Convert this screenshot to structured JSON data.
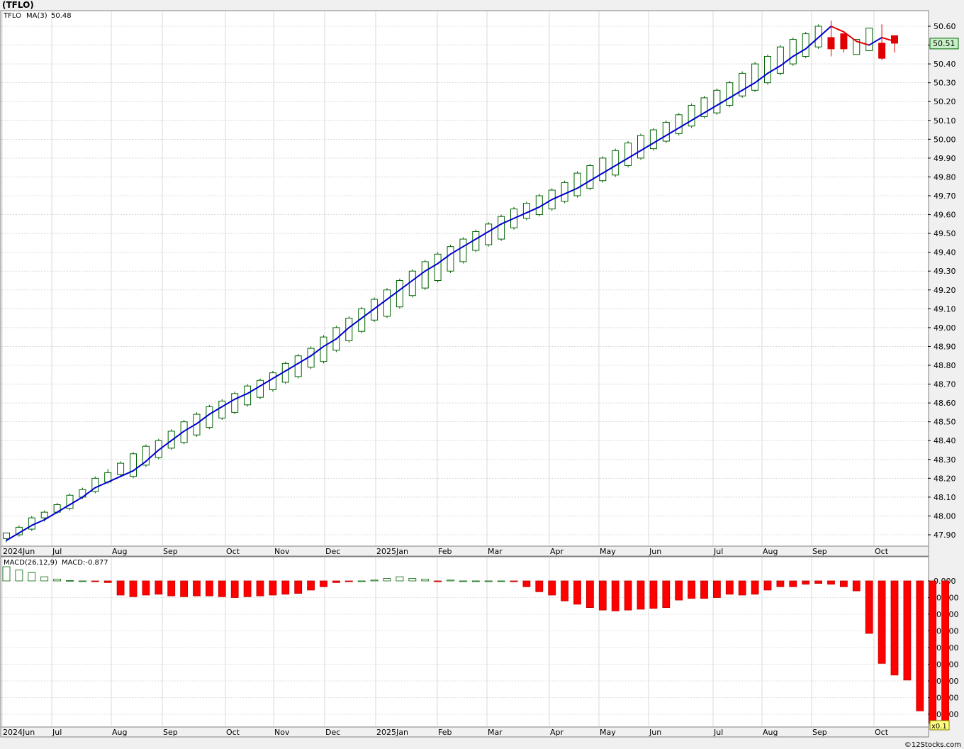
{
  "title": "(TFLO)",
  "credit": "©12Stocks.com",
  "price_panel": {
    "symbol": "TFLO",
    "ma_label": "MA(3)",
    "ma_value": "50.48",
    "last_price_label": "50.51",
    "y_ticks": [
      "47.90",
      "48.00",
      "48.10",
      "48.20",
      "48.30",
      "48.40",
      "48.50",
      "48.60",
      "48.70",
      "48.80",
      "48.90",
      "49.00",
      "49.10",
      "49.20",
      "49.30",
      "49.40",
      "49.50",
      "49.60",
      "49.70",
      "49.80",
      "49.90",
      "50.00",
      "50.10",
      "50.20",
      "50.30",
      "50.40",
      "50.50",
      "50.60"
    ]
  },
  "macd_panel": {
    "label": "MACD(26,12,9)",
    "value_label": "MACD:-0.877",
    "scale_label": "x0.1",
    "y_ticks": [
      "0.000",
      "-0.100",
      "-0.200",
      "-0.300",
      "-0.400",
      "-0.500",
      "-0.600",
      "-0.700",
      "-0.800"
    ]
  },
  "x_axis_labels": [
    "2024Jun",
    "Jul",
    "Aug",
    "Sep",
    "Oct",
    "Nov",
    "Dec",
    "2025Jan",
    "Feb",
    "Mar",
    "Apr",
    "May",
    "Jun",
    "Jul",
    "Aug",
    "Sep",
    "Oct"
  ],
  "colors": {
    "up_candle_fill": "#ffffff",
    "up_candle_stroke": "#006400",
    "down_candle": "#e00000",
    "ma_up": "#0000d0",
    "ma_down": "#e00000",
    "macd_bar": "#ff0000",
    "grid": "#c0c0c0",
    "price_label_bg": "#c8f0c8"
  },
  "chart_data": [
    {
      "type": "candlestick",
      "title": "(TFLO)",
      "ylim": [
        47.86,
        50.65
      ],
      "x": [
        "2024-06-03",
        "2024-06-10",
        "2024-06-17",
        "2024-06-24",
        "2024-07-01",
        "2024-07-08",
        "2024-07-15",
        "2024-07-22",
        "2024-07-29",
        "2024-08-05",
        "2024-08-12",
        "2024-08-19",
        "2024-08-26",
        "2024-09-02",
        "2024-09-09",
        "2024-09-16",
        "2024-09-23",
        "2024-09-30",
        "2024-10-07",
        "2024-10-14",
        "2024-10-21",
        "2024-10-28",
        "2024-11-04",
        "2024-11-11",
        "2024-11-18",
        "2024-11-25",
        "2024-12-02",
        "2024-12-09",
        "2024-12-16",
        "2024-12-23",
        "2024-12-30",
        "2025-01-06",
        "2025-01-13",
        "2025-01-20",
        "2025-01-27",
        "2025-02-03",
        "2025-02-10",
        "2025-02-17",
        "2025-02-24",
        "2025-03-03",
        "2025-03-10",
        "2025-03-17",
        "2025-03-24",
        "2025-03-31",
        "2025-04-07",
        "2025-04-14",
        "2025-04-21",
        "2025-04-28",
        "2025-05-05",
        "2025-05-12",
        "2025-05-19",
        "2025-05-26",
        "2025-06-02",
        "2025-06-09",
        "2025-06-16",
        "2025-06-23",
        "2025-06-30",
        "2025-07-07",
        "2025-07-14",
        "2025-07-21",
        "2025-07-28",
        "2025-08-04",
        "2025-08-11",
        "2025-08-18",
        "2025-08-25",
        "2025-09-01",
        "2025-09-08",
        "2025-09-15",
        "2025-09-22",
        "2025-09-29",
        "2025-10-06"
      ],
      "open": [
        47.88,
        47.9,
        47.93,
        47.99,
        48.02,
        48.04,
        48.1,
        48.13,
        48.18,
        48.22,
        48.21,
        48.27,
        48.31,
        48.36,
        48.39,
        48.43,
        48.47,
        48.52,
        48.55,
        48.59,
        48.63,
        48.67,
        48.71,
        48.74,
        48.79,
        48.82,
        48.88,
        48.93,
        48.98,
        49.04,
        49.06,
        49.11,
        49.17,
        49.21,
        49.25,
        49.3,
        49.35,
        49.41,
        49.44,
        49.47,
        49.53,
        49.58,
        49.6,
        49.63,
        49.67,
        49.7,
        49.74,
        49.78,
        49.81,
        49.86,
        49.9,
        49.95,
        49.99,
        50.03,
        50.07,
        50.12,
        50.14,
        50.18,
        50.23,
        50.26,
        50.3,
        50.35,
        50.4,
        50.44,
        50.49,
        50.54,
        50.56,
        50.45,
        50.47,
        50.51,
        50.55
      ],
      "high": [
        47.91,
        47.95,
        48.0,
        48.03,
        48.07,
        48.12,
        48.15,
        48.21,
        48.25,
        48.29,
        48.34,
        48.38,
        48.41,
        48.46,
        48.51,
        48.55,
        48.59,
        48.62,
        48.66,
        48.7,
        48.73,
        48.77,
        48.82,
        48.86,
        48.9,
        48.96,
        49.01,
        49.06,
        49.11,
        49.16,
        49.21,
        49.26,
        49.31,
        49.36,
        49.4,
        49.44,
        49.48,
        49.52,
        49.56,
        49.6,
        49.64,
        49.67,
        49.71,
        49.74,
        49.78,
        49.83,
        49.87,
        49.91,
        49.95,
        49.99,
        50.03,
        50.06,
        50.1,
        50.14,
        50.19,
        50.23,
        50.27,
        50.31,
        50.36,
        50.41,
        50.45,
        50.5,
        50.54,
        50.57,
        50.61,
        50.63,
        50.5,
        50.51,
        50.57,
        50.61,
        50.51
      ],
      "low": [
        47.86,
        47.89,
        47.92,
        47.97,
        48.01,
        48.03,
        48.09,
        48.12,
        48.17,
        48.21,
        48.2,
        48.26,
        48.3,
        48.35,
        48.38,
        48.42,
        48.46,
        48.51,
        48.54,
        48.58,
        48.62,
        48.66,
        48.7,
        48.73,
        48.78,
        48.81,
        48.87,
        48.92,
        48.97,
        49.03,
        49.05,
        49.1,
        49.16,
        49.2,
        49.24,
        49.29,
        49.34,
        49.4,
        49.43,
        49.46,
        49.52,
        49.57,
        49.59,
        49.62,
        49.66,
        49.69,
        49.73,
        49.77,
        49.8,
        49.85,
        49.89,
        49.94,
        49.98,
        50.02,
        50.06,
        50.11,
        50.13,
        50.17,
        50.22,
        50.25,
        50.29,
        50.34,
        50.39,
        50.43,
        50.48,
        50.44,
        50.46,
        50.49,
        50.52,
        50.42,
        50.46
      ],
      "close": [
        47.91,
        47.94,
        47.99,
        48.02,
        48.06,
        48.11,
        48.14,
        48.2,
        48.23,
        48.28,
        48.33,
        48.37,
        48.4,
        48.45,
        48.5,
        48.54,
        48.58,
        48.61,
        48.65,
        48.69,
        48.72,
        48.76,
        48.81,
        48.85,
        48.89,
        48.95,
        49.0,
        49.05,
        49.1,
        49.15,
        49.2,
        49.25,
        49.3,
        49.35,
        49.39,
        49.43,
        49.47,
        49.51,
        49.55,
        49.59,
        49.63,
        49.66,
        49.7,
        49.73,
        49.77,
        49.82,
        49.86,
        49.9,
        49.94,
        49.98,
        50.02,
        50.05,
        50.09,
        50.13,
        50.18,
        50.22,
        50.26,
        50.3,
        50.35,
        50.4,
        50.44,
        50.49,
        50.53,
        50.56,
        50.6,
        50.48,
        50.48,
        50.53,
        50.59,
        50.43,
        50.51
      ],
      "ma3": [
        47.87,
        47.91,
        47.95,
        47.98,
        48.02,
        48.06,
        48.1,
        48.15,
        48.18,
        48.21,
        48.24,
        48.29,
        48.35,
        48.4,
        48.45,
        48.49,
        48.54,
        48.58,
        48.62,
        48.65,
        48.69,
        48.73,
        48.77,
        48.81,
        48.85,
        48.9,
        48.94,
        49.0,
        49.05,
        49.1,
        49.15,
        49.2,
        49.25,
        49.3,
        49.34,
        49.39,
        49.43,
        49.47,
        49.51,
        49.55,
        49.58,
        49.61,
        49.64,
        49.68,
        49.71,
        49.74,
        49.78,
        49.82,
        49.86,
        49.9,
        49.94,
        49.98,
        50.02,
        50.06,
        50.1,
        50.14,
        50.18,
        50.22,
        50.26,
        50.3,
        50.35,
        50.39,
        50.44,
        50.48,
        50.54,
        50.6,
        50.57,
        50.52,
        50.5,
        50.54,
        50.52,
        50.49
      ]
    },
    {
      "type": "bar",
      "title": "MACD(26,12,9)",
      "ylim": [
        -0.88,
        0.08
      ],
      "values": [
        0.085,
        0.065,
        0.05,
        0.025,
        0.01,
        0.002,
        0.0,
        -0.005,
        -0.01,
        -0.085,
        -0.095,
        -0.085,
        -0.08,
        -0.09,
        -0.095,
        -0.09,
        -0.09,
        -0.095,
        -0.1,
        -0.095,
        -0.09,
        -0.085,
        -0.08,
        -0.075,
        -0.055,
        -0.035,
        -0.01,
        -0.005,
        0.0,
        0.005,
        0.015,
        0.025,
        0.015,
        0.01,
        -0.005,
        0.005,
        0.0,
        0.0,
        0.0,
        0.0,
        -0.005,
        -0.035,
        -0.065,
        -0.085,
        -0.12,
        -0.14,
        -0.16,
        -0.175,
        -0.18,
        -0.175,
        -0.17,
        -0.165,
        -0.16,
        -0.115,
        -0.105,
        -0.105,
        -0.1,
        -0.08,
        -0.085,
        -0.08,
        -0.055,
        -0.035,
        -0.035,
        -0.02,
        -0.015,
        -0.02,
        -0.035,
        -0.06,
        -0.315,
        -0.495,
        -0.565,
        -0.595,
        -0.78,
        -0.855,
        -0.877
      ]
    }
  ]
}
